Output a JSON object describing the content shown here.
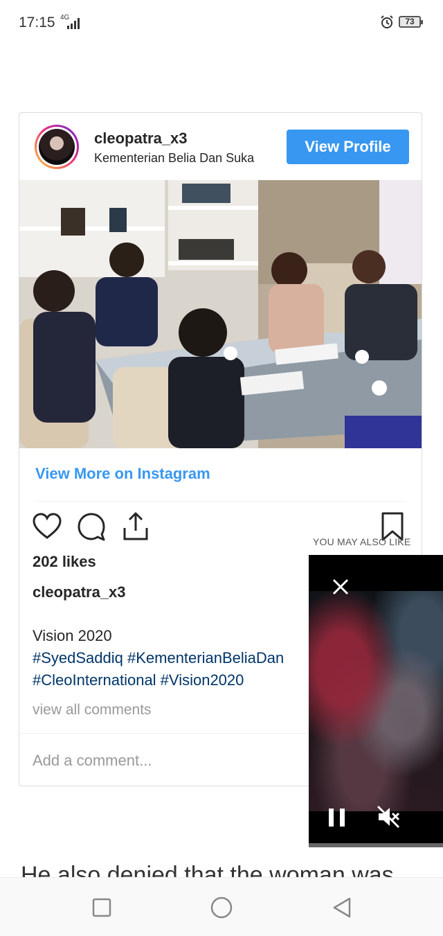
{
  "status_bar": {
    "time": "17:15",
    "network": "4G",
    "battery": "73"
  },
  "embed": {
    "username": "cleopatra_x3",
    "location": "Kementerian Belia Dan Suka",
    "view_profile_label": "View Profile",
    "view_more_label": "View More on Instagram",
    "likes": "202 likes",
    "caption_user": "cleopatra_x3",
    "caption_text": "Vision 2020",
    "hashtags_line1": "#SyedSaddiq #KementerianBeliaDan",
    "hashtags_line2": "#CleoInternational #Vision2020",
    "view_comments": "view all comments",
    "add_comment_placeholder": "Add a comment..."
  },
  "overlay": {
    "you_may_also_like": "YOU MAY ALSO LIKE"
  },
  "article": {
    "partial_text": "He also denied that the woman was"
  },
  "colors": {
    "accent": "#3897f0",
    "hashtag": "#003569",
    "text": "#262626",
    "muted": "#999999"
  }
}
